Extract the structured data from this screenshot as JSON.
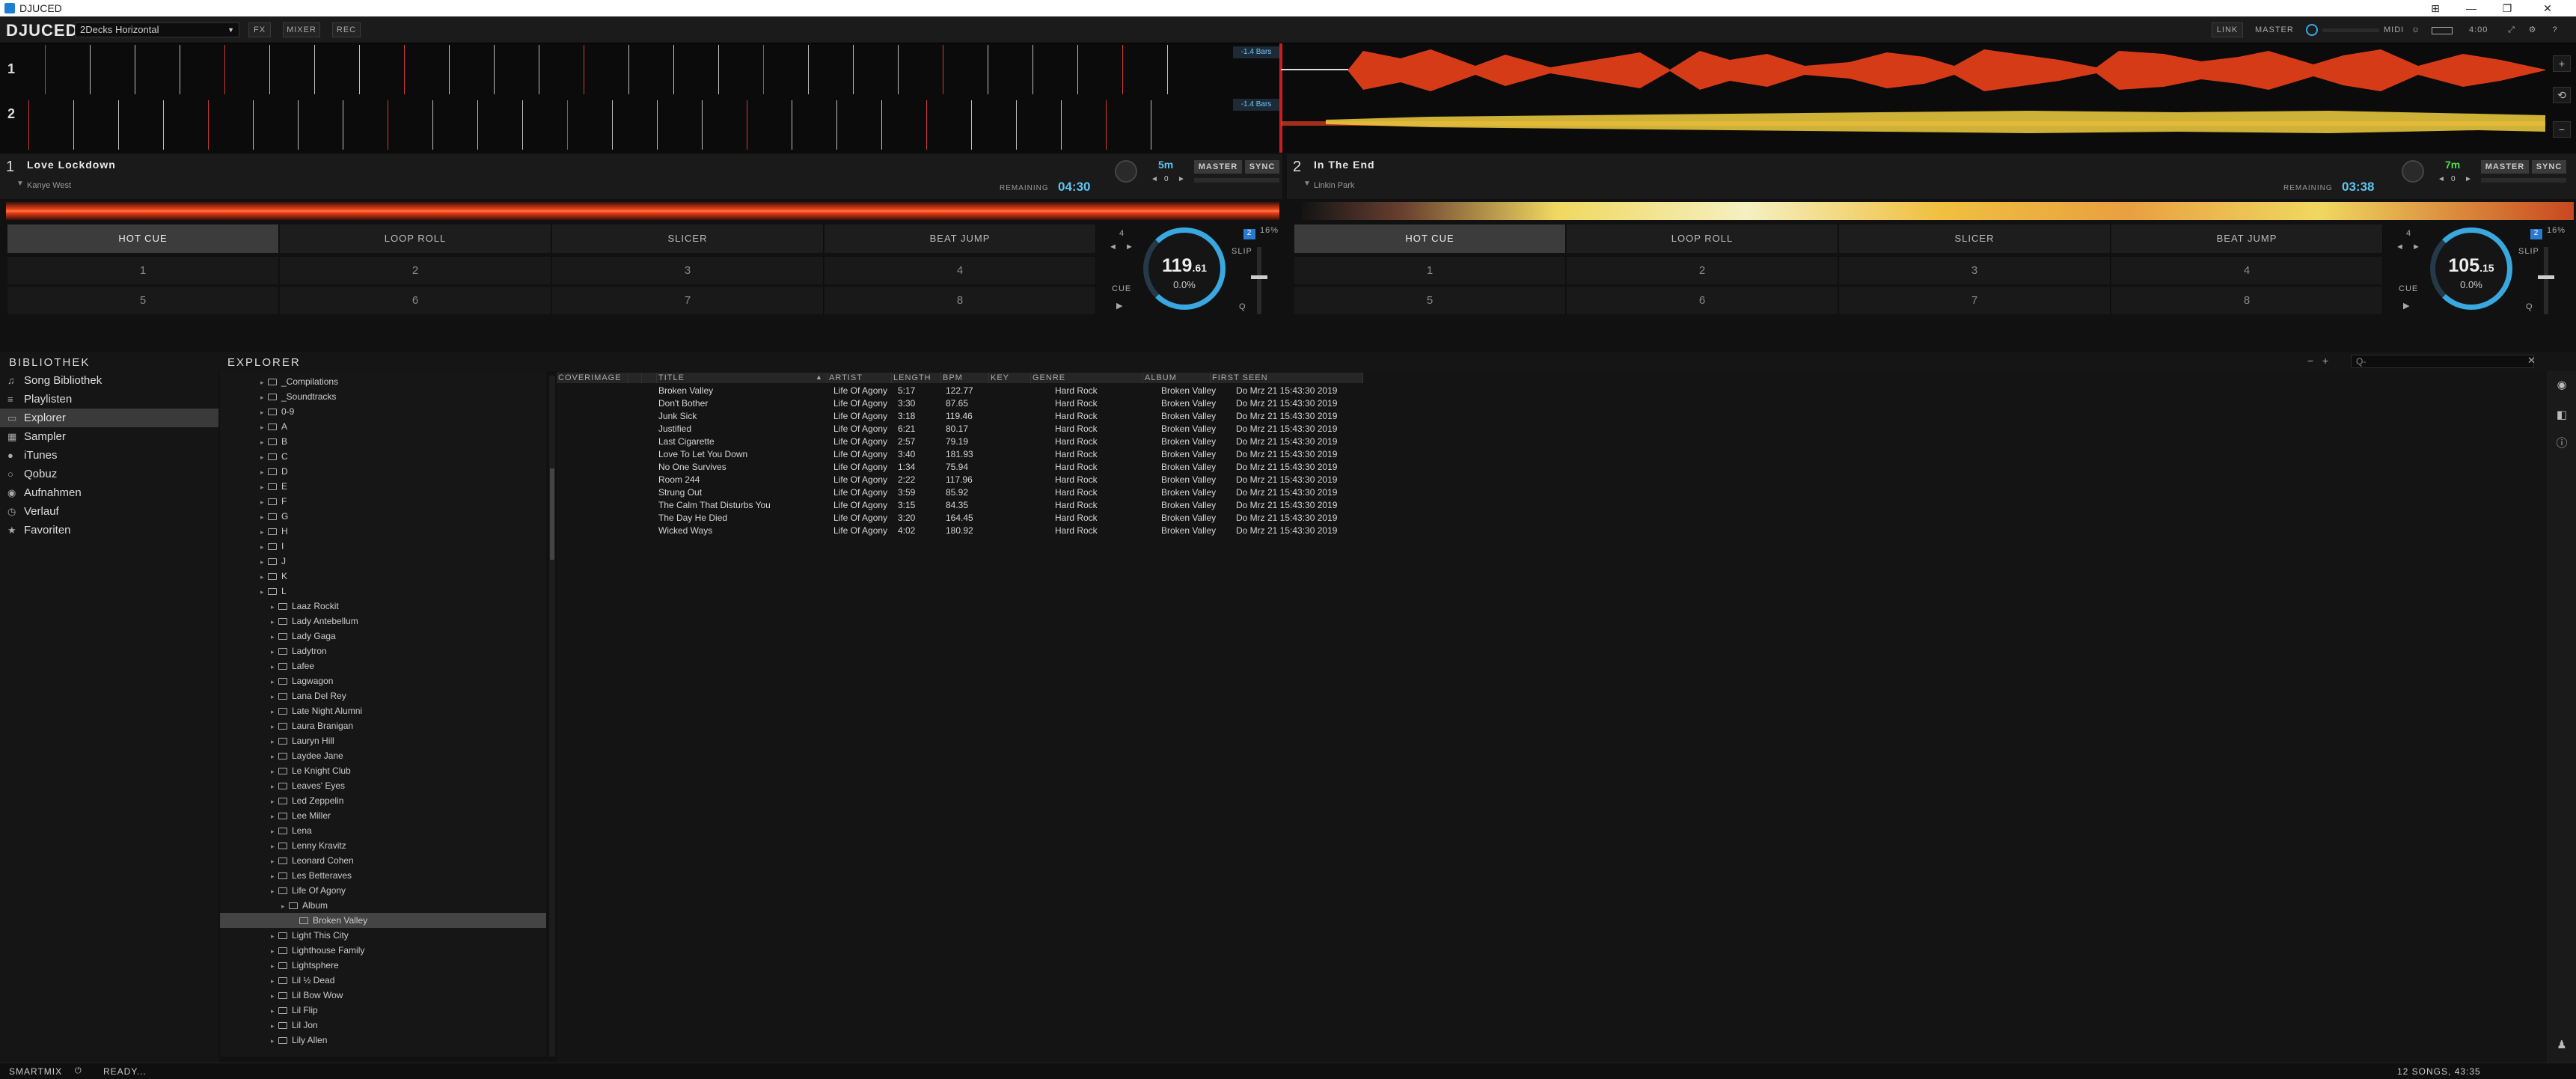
{
  "window": {
    "title": "DJUCED"
  },
  "toolbar": {
    "logo": "DJUCED",
    "layout_value": "2Decks Horizontal",
    "fx": "FX",
    "mixer": "MIXER",
    "rec": "REC",
    "link": "LINK",
    "master": "MASTER",
    "midi": "MIDI",
    "time": "4:00"
  },
  "overview": {
    "lane1": "1",
    "lane2": "2",
    "bars1": "-1.4 Bars",
    "bars2": "-1.4 Bars",
    "zoom_in": "+",
    "zoom_out": "−"
  },
  "deck1": {
    "number": "1",
    "title": "Love Lockdown",
    "artist": "Kanye West",
    "remaining_label": "REMAINING",
    "remaining": "04:30",
    "key": "5m",
    "master": "MASTER",
    "sync": "SYNC",
    "key_offset": "0",
    "tabs": [
      "HOT CUE",
      "LOOP ROLL",
      "SLICER",
      "BEAT JUMP"
    ],
    "pads": [
      "1",
      "2",
      "3",
      "4",
      "5",
      "6",
      "7",
      "8"
    ],
    "loop": "4",
    "cue": "CUE",
    "slip": "SLIP",
    "q": "Q",
    "pitch_range": "16%",
    "bpm_int": "119",
    "bpm_dec": ".61",
    "pitch": "0.0%"
  },
  "deck2": {
    "number": "2",
    "title": "In The End",
    "artist": "Linkin Park",
    "remaining_label": "REMAINING",
    "remaining": "03:38",
    "key": "7m",
    "master": "MASTER",
    "sync": "SYNC",
    "key_offset": "0",
    "tabs": [
      "HOT CUE",
      "LOOP ROLL",
      "SLICER",
      "BEAT JUMP"
    ],
    "pads": [
      "1",
      "2",
      "3",
      "4",
      "5",
      "6",
      "7",
      "8"
    ],
    "loop": "4",
    "cue": "CUE",
    "slip": "SLIP",
    "q": "Q",
    "pitch_range": "16%",
    "bpm_int": "105",
    "bpm_dec": ".15",
    "pitch": "0.0%"
  },
  "library": {
    "sidebar_title": "BIBLIOTHEK",
    "explorer_title": "EXPLORER",
    "search_placeholder": "Q-",
    "sidebar": [
      {
        "label": "Song Bibliothek",
        "icon": "music-icon"
      },
      {
        "label": "Playlisten",
        "icon": "playlist-icon"
      },
      {
        "label": "Explorer",
        "icon": "folder-icon"
      },
      {
        "label": "Sampler",
        "icon": "sampler-icon"
      },
      {
        "label": "iTunes",
        "icon": "itunes-icon"
      },
      {
        "label": "Qobuz",
        "icon": "qobuz-icon"
      },
      {
        "label": "Aufnahmen",
        "icon": "record-icon"
      },
      {
        "label": "Verlauf",
        "icon": "history-icon"
      },
      {
        "label": "Favoriten",
        "icon": "star-icon"
      }
    ],
    "tree": [
      {
        "label": "_Compilations",
        "depth": 1
      },
      {
        "label": "_Soundtracks",
        "depth": 1
      },
      {
        "label": "0-9",
        "depth": 1
      },
      {
        "label": "A",
        "depth": 1
      },
      {
        "label": "B",
        "depth": 1
      },
      {
        "label": "C",
        "depth": 1
      },
      {
        "label": "D",
        "depth": 1
      },
      {
        "label": "E",
        "depth": 1
      },
      {
        "label": "F",
        "depth": 1
      },
      {
        "label": "G",
        "depth": 1
      },
      {
        "label": "H",
        "depth": 1
      },
      {
        "label": "I",
        "depth": 1
      },
      {
        "label": "J",
        "depth": 1
      },
      {
        "label": "K",
        "depth": 1
      },
      {
        "label": "L",
        "depth": 1
      },
      {
        "label": "Laaz Rockit",
        "depth": 2
      },
      {
        "label": "Lady Antebellum",
        "depth": 2
      },
      {
        "label": "Lady Gaga",
        "depth": 2
      },
      {
        "label": "Ladytron",
        "depth": 2
      },
      {
        "label": "Lafee",
        "depth": 2
      },
      {
        "label": "Lagwagon",
        "depth": 2
      },
      {
        "label": "Lana Del Rey",
        "depth": 2
      },
      {
        "label": "Late Night Alumni",
        "depth": 2
      },
      {
        "label": "Laura Branigan",
        "depth": 2
      },
      {
        "label": "Lauryn Hill",
        "depth": 2
      },
      {
        "label": "Laydee Jane",
        "depth": 2
      },
      {
        "label": "Le Knight Club",
        "depth": 2
      },
      {
        "label": "Leaves' Eyes",
        "depth": 2
      },
      {
        "label": "Led Zeppelin",
        "depth": 2
      },
      {
        "label": "Lee Miller",
        "depth": 2
      },
      {
        "label": "Lena",
        "depth": 2
      },
      {
        "label": "Lenny Kravitz",
        "depth": 2
      },
      {
        "label": "Leonard Cohen",
        "depth": 2
      },
      {
        "label": "Les Betteraves",
        "depth": 2
      },
      {
        "label": "Life Of Agony",
        "depth": 2
      },
      {
        "label": "Album",
        "depth": 3
      },
      {
        "label": "Broken Valley",
        "depth": 4,
        "selected": true
      },
      {
        "label": "Light This City",
        "depth": 2
      },
      {
        "label": "Lighthouse Family",
        "depth": 2
      },
      {
        "label": "Lightsphere",
        "depth": 2
      },
      {
        "label": "Lil ½ Dead",
        "depth": 2
      },
      {
        "label": "Lil Bow Wow",
        "depth": 2
      },
      {
        "label": "Lil Flip",
        "depth": 2
      },
      {
        "label": "Lil Jon",
        "depth": 2
      },
      {
        "label": "Lily Allen",
        "depth": 2
      }
    ],
    "columns": [
      "COVERIMAGE",
      "TITLE",
      "ARTIST",
      "LENGTH",
      "BPM",
      "KEY",
      "GENRE",
      "ALBUM",
      "FIRST SEEN"
    ],
    "rows": [
      {
        "title": "Broken Valley",
        "artist": "Life Of Agony",
        "length": "5:17",
        "bpm": "122.77",
        "key": "",
        "genre": "Hard Rock",
        "album": "Broken Valley",
        "first_seen": "Do Mrz 21 15:43:30 2019"
      },
      {
        "title": "Don't Bother",
        "artist": "Life Of Agony",
        "length": "3:30",
        "bpm": "87.65",
        "key": "",
        "genre": "Hard Rock",
        "album": "Broken Valley",
        "first_seen": "Do Mrz 21 15:43:30 2019"
      },
      {
        "title": "Junk Sick",
        "artist": "Life Of Agony",
        "length": "3:18",
        "bpm": "119.46",
        "key": "",
        "genre": "Hard Rock",
        "album": "Broken Valley",
        "first_seen": "Do Mrz 21 15:43:30 2019"
      },
      {
        "title": "Justified",
        "artist": "Life Of Agony",
        "length": "6:21",
        "bpm": "80.17",
        "key": "",
        "genre": "Hard Rock",
        "album": "Broken Valley",
        "first_seen": "Do Mrz 21 15:43:30 2019"
      },
      {
        "title": "Last Cigarette",
        "artist": "Life Of Agony",
        "length": "2:57",
        "bpm": "79.19",
        "key": "",
        "genre": "Hard Rock",
        "album": "Broken Valley",
        "first_seen": "Do Mrz 21 15:43:30 2019"
      },
      {
        "title": "Love To Let You Down",
        "artist": "Life Of Agony",
        "length": "3:40",
        "bpm": "181.93",
        "key": "",
        "genre": "Hard Rock",
        "album": "Broken Valley",
        "first_seen": "Do Mrz 21 15:43:30 2019"
      },
      {
        "title": "No One Survives",
        "artist": "Life Of Agony",
        "length": "1:34",
        "bpm": "75.94",
        "key": "",
        "genre": "Hard Rock",
        "album": "Broken Valley",
        "first_seen": "Do Mrz 21 15:43:30 2019"
      },
      {
        "title": "Room 244",
        "artist": "Life Of Agony",
        "length": "2:22",
        "bpm": "117.96",
        "key": "",
        "genre": "Hard Rock",
        "album": "Broken Valley",
        "first_seen": "Do Mrz 21 15:43:30 2019"
      },
      {
        "title": "Strung Out",
        "artist": "Life Of Agony",
        "length": "3:59",
        "bpm": "85.92",
        "key": "",
        "genre": "Hard Rock",
        "album": "Broken Valley",
        "first_seen": "Do Mrz 21 15:43:30 2019"
      },
      {
        "title": "The Calm That Disturbs You",
        "artist": "Life Of Agony",
        "length": "3:15",
        "bpm": "84.35",
        "key": "",
        "genre": "Hard Rock",
        "album": "Broken Valley",
        "first_seen": "Do Mrz 21 15:43:30 2019"
      },
      {
        "title": "The Day He Died",
        "artist": "Life Of Agony",
        "length": "3:20",
        "bpm": "164.45",
        "key": "",
        "genre": "Hard Rock",
        "album": "Broken Valley",
        "first_seen": "Do Mrz 21 15:43:30 2019"
      },
      {
        "title": "Wicked Ways",
        "artist": "Life Of Agony",
        "length": "4:02",
        "bpm": "180.92",
        "key": "",
        "genre": "Hard Rock",
        "album": "Broken Valley",
        "first_seen": "Do Mrz 21 15:43:30 2019"
      }
    ]
  },
  "status": {
    "smartmix": "SMARTMIX",
    "state": "READY...",
    "summary": "12 SONGS, 43:35"
  },
  "colors": {
    "accent": "#3aa8e0",
    "wave_red": "#e8401a",
    "wave_yellow": "#f5e04a",
    "bg": "#111111"
  }
}
